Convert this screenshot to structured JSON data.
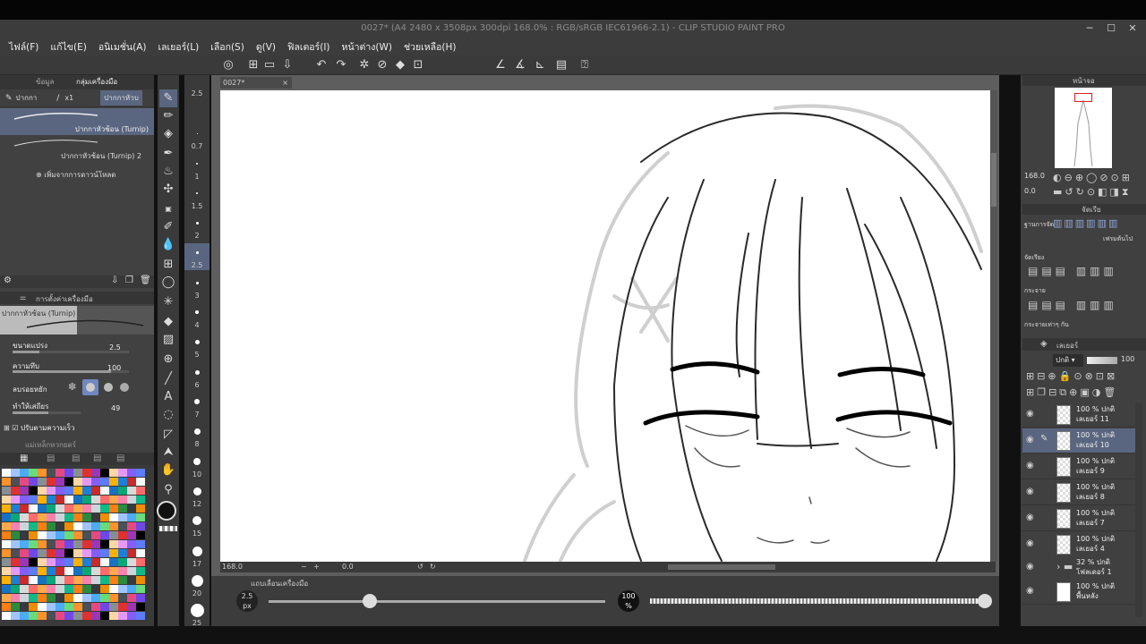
{
  "app_title": "0027* (A4 2480 x 3508px 300dpi 168.0% : RGB/sRGB IEC61966-2.1) - CLIP STUDIO PAINT PRO",
  "menu": [
    "ไฟล์(F)",
    "แก้ไข(E)",
    "อนิเมชั่น(A)",
    "เลเยอร์(L)",
    "เลือก(S)",
    "ดู(V)",
    "ฟิลเตอร์(I)",
    "หน้าต่าง(W)",
    "ช่วยเหลือ(H)"
  ],
  "left_tabs": {
    "tab1": "ข้อมูล",
    "tab2": "กลุ่มเครื่องมือ"
  },
  "tool_groups": [
    "ปากกา",
    "x1",
    "ปากกาหัวบ"
  ],
  "brushes": [
    {
      "name": "ปากกาหัวช้อน (Turnip)"
    },
    {
      "name": "ปากกาหัวช้อน (Turnip) 2"
    }
  ],
  "add_material": "เพิ่มจากการดาวน์โหลด",
  "tool_property_title": "การตั้งค่าเครื่องมือ",
  "current_brush": "ปากกาหัวช้อน (Turnip)",
  "props": {
    "brush_size_label": "ขนาดแปรง",
    "brush_size": "2.5",
    "opacity_label": "ความทึบ",
    "opacity": "100",
    "antialias_label": "ลบรอยหยัก",
    "stabilize_label": "ทำให้เสถียร",
    "stabilize": "49",
    "speed_label": "ปรับตามความเร็ว",
    "sub_label": "แม่เหล็กหวกยดร์"
  },
  "size_presets": [
    "2.5",
    "0.7",
    "1",
    "1.5",
    "2",
    "2.5",
    "3",
    "4",
    "5",
    "6",
    "7",
    "8",
    "10",
    "12",
    "15",
    "17",
    "20",
    "25"
  ],
  "document_tab": "0027*",
  "status": {
    "zoom": "168.0",
    "angle": "0.0"
  },
  "bottom": {
    "panel_label": "แถบเลื่อนเครื่องมือ",
    "size_value": "2.5",
    "size_unit": "px",
    "opacity_value": "100",
    "opacity_unit": "%",
    "size_fraction": 0.3,
    "opacity_fraction": 1.0
  },
  "navigator": {
    "tab": "หน้าจอ",
    "zoom": "168.0",
    "angle": "0.0"
  },
  "align": {
    "base_label": "ฐานการจัด",
    "target_label": "เฟรมต้นไป",
    "align_label": "จัดเรียง",
    "distribute_label": "กระจาย",
    "distribute_space_label": "กระจายเท่าๆ กัน",
    "tab_label": "จัดเรีย"
  },
  "layers_panel": {
    "title": "เลเยอร์",
    "blend": "ปกติ",
    "opacity": "100",
    "layers": [
      {
        "pct": "100 %",
        "mode": "ปกติ",
        "name": "เลเยอร์ 11"
      },
      {
        "pct": "100 %",
        "mode": "ปกติ",
        "name": "เลเยอร์ 10"
      },
      {
        "pct": "100 %",
        "mode": "ปกติ",
        "name": "เลเยอร์ 9"
      },
      {
        "pct": "100 %",
        "mode": "ปกติ",
        "name": "เลเยอร์ 8"
      },
      {
        "pct": "100 %",
        "mode": "ปกติ",
        "name": "เลเยอร์ 7"
      },
      {
        "pct": "100 %",
        "mode": "ปกติ",
        "name": "เลเยอร์ 4"
      },
      {
        "pct": "32 %",
        "mode": "ปกติ",
        "name": "โฟลเดอร์ 1"
      },
      {
        "pct": "100 %",
        "mode": "ปกติ",
        "name": "พื้นหลัง"
      }
    ]
  },
  "colors": {
    "selected_layer": "#5a6680",
    "accent": "#6f88c0"
  }
}
